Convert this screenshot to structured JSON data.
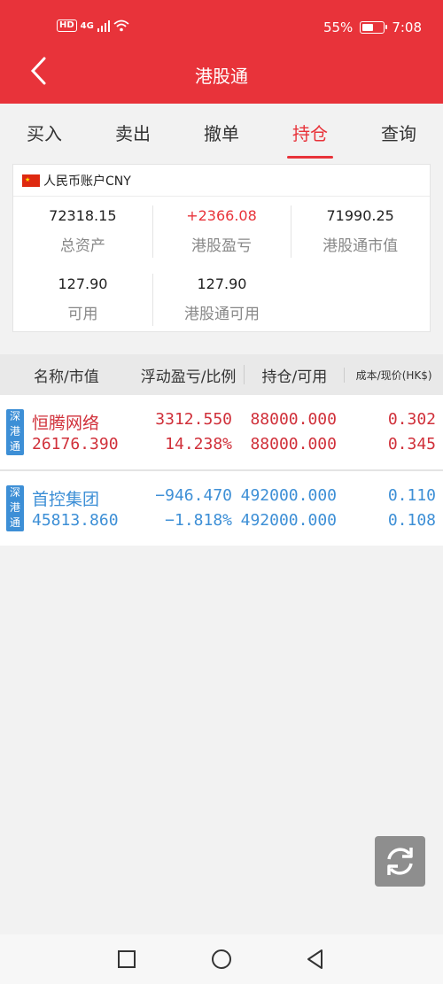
{
  "status_bar": {
    "hd": "HD",
    "network": "4G",
    "battery_text": "55%",
    "battery_level": 0.55,
    "time": "7:08"
  },
  "header": {
    "title": "港股通",
    "back_icon": "chevron-left-icon"
  },
  "tabs": [
    {
      "label": "买入",
      "active": false
    },
    {
      "label": "卖出",
      "active": false
    },
    {
      "label": "撤单",
      "active": false
    },
    {
      "label": "持仓",
      "active": true
    },
    {
      "label": "查询",
      "active": false
    }
  ],
  "account": {
    "label": "人民币账户CNY",
    "flag_icon": "china-flag-icon",
    "stats": [
      {
        "value": "72318.15",
        "label": "总资产"
      },
      {
        "value": "+2366.08",
        "label": "港股盈亏"
      },
      {
        "value": "71990.25",
        "label": "港股通市值"
      },
      {
        "value": "127.90",
        "label": "可用"
      },
      {
        "value": "127.90",
        "label": "港股通可用"
      }
    ]
  },
  "table": {
    "headers": [
      "名称/市值",
      "浮动盈亏/比例",
      "持仓/可用",
      "成本/现价(HK$)"
    ],
    "rows": [
      {
        "tag": "深港通",
        "name": "恒腾网络",
        "market_value": "26176.390",
        "pnl": "3312.550",
        "pnl_pct": "14.238%",
        "position": "88000.000",
        "available": "88000.000",
        "cost": "0.302",
        "price": "0.345",
        "color": "#d0303a"
      },
      {
        "tag": "深港通",
        "name": "首控集团",
        "market_value": "45813.860",
        "pnl": "−946.470",
        "pnl_pct": "−1.818%",
        "position": "492000.000",
        "available": "492000.000",
        "cost": "0.110",
        "price": "0.108",
        "color": "#3d8fd6"
      }
    ]
  },
  "refresh_icon": "refresh-icon",
  "nav": {
    "recent_icon": "square-icon",
    "home_icon": "circle-icon",
    "back_icon": "triangle-back-icon"
  }
}
